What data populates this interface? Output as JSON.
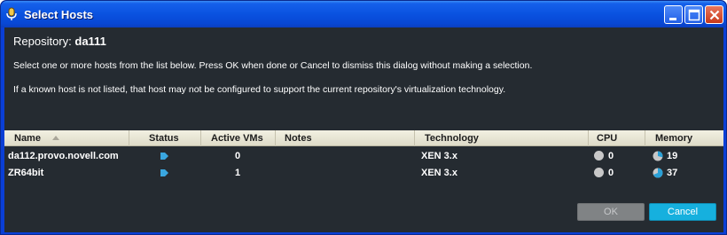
{
  "window": {
    "title": "Select Hosts",
    "icon": "microphone-icon",
    "controls": [
      "minimize-icon",
      "maximize-icon",
      "close-icon"
    ]
  },
  "dialog": {
    "repository_label": "Repository:",
    "repository_name": "da111",
    "instruction_1": "Select one or more hosts from the list below.  Press OK when done or Cancel to dismiss this dialog without making a selection.",
    "instruction_2": "If a known host is not listed, that host may not be configured to support the current repository's virtualization technology."
  },
  "table": {
    "columns": [
      "Name",
      "Status",
      "Active VMs",
      "Notes",
      "Technology",
      "CPU",
      "Memory"
    ],
    "sort_column": "Name",
    "rows": [
      {
        "name": "da112.provo.novell.com",
        "status": "flag-icon",
        "active_vms": "0",
        "notes": "",
        "technology": "XEN 3.x",
        "cpu": "0",
        "memory": "19"
      },
      {
        "name": "ZR64bit",
        "status": "flag-icon",
        "active_vms": "1",
        "notes": "",
        "technology": "XEN 3.x",
        "cpu": "0",
        "memory": "37"
      }
    ]
  },
  "buttons": {
    "ok": "OK",
    "cancel": "Cancel"
  },
  "colors": {
    "titlebar": "#0a52e0",
    "client_bg": "#252b31",
    "header_bg": "#e9e6d4",
    "status_icon": "#3aa7e0",
    "cancel_button": "#16b0de",
    "ok_button_disabled": "#808385"
  }
}
